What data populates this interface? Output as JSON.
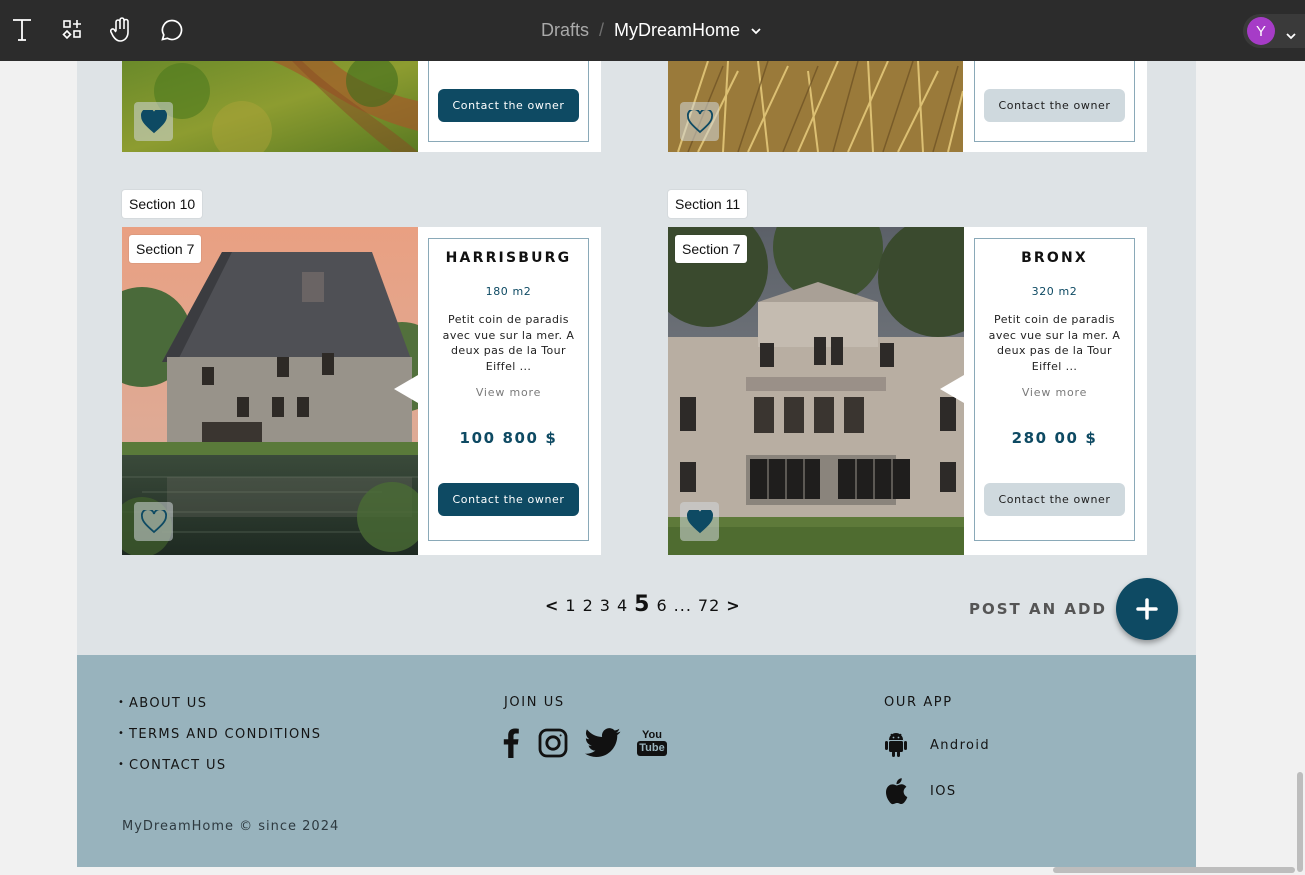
{
  "toolbar": {
    "icons": [
      "text-tool-icon",
      "components-icon",
      "hand-tool-icon",
      "comment-icon"
    ],
    "breadcrumb": {
      "parent": "Drafts",
      "separator": "/",
      "file": "MyDreamHome"
    },
    "user_initial": "Y"
  },
  "top_cards": [
    {
      "button": "Contact the owner",
      "button_style": "dark",
      "favorited": true
    },
    {
      "button": "Contact the owner",
      "button_style": "light",
      "favorited": false
    }
  ],
  "sections": [
    {
      "frame_label": "Section 10",
      "inner_label": "Section 7",
      "city": "HARRISBURG",
      "area": "180 m2",
      "description": "Petit coin de paradis avec vue sur la mer. A deux pas de la Tour Eiffel ...",
      "view_more": "View more",
      "price": "100 800 $",
      "button": "Contact the owner",
      "button_style": "dark",
      "favorited": false
    },
    {
      "frame_label": "Section 11",
      "inner_label": "Section 7",
      "city": "BRONX",
      "area": "320 m2",
      "description": "Petit coin de paradis avec vue sur la mer. A deux pas de la Tour Eiffel ...",
      "view_more": "View more",
      "price": "280 00 $",
      "button": "Contact the owner",
      "button_style": "light",
      "favorited": true
    }
  ],
  "pagination": {
    "prev": "<",
    "pages": [
      "1",
      "2",
      "3",
      "4"
    ],
    "current": "5",
    "after": [
      "6",
      "...",
      "72"
    ],
    "next": ">"
  },
  "post_add": {
    "label": "POST AN ADD",
    "button": "+"
  },
  "footer": {
    "links": [
      "ABOUT US",
      "TERMS AND CONDITIONS",
      "CONTACT US"
    ],
    "join_title": "JOIN US",
    "social": [
      "facebook-icon",
      "instagram-icon",
      "twitter-icon",
      "youtube-icon"
    ],
    "youtube_text": [
      "You",
      "Tube"
    ],
    "app_title": "OUR APP",
    "apps": [
      {
        "icon": "android-icon",
        "label": "Android"
      },
      {
        "icon": "apple-icon",
        "label": "IOS"
      }
    ],
    "copyright": "MyDreamHome © since 2024"
  },
  "colors": {
    "accent": "#0e4a63",
    "frame_bg": "#dee3e6",
    "footer_bg": "#98b3bd",
    "toolbar_bg": "#2c2c2c",
    "avatar": "#a63cc7"
  }
}
